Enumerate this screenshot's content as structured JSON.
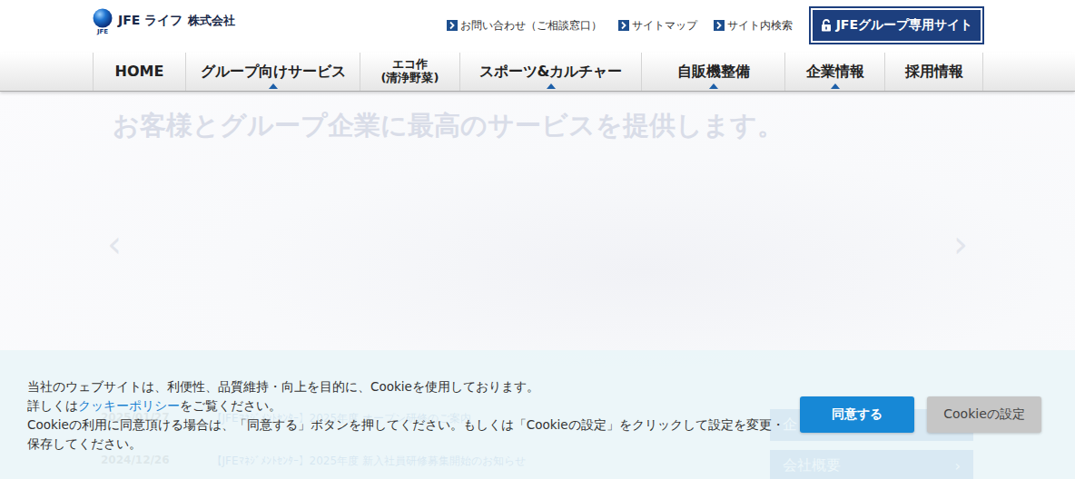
{
  "logo": {
    "mark": "JFE",
    "name": "JFE ライフ",
    "suffix": "株式会社"
  },
  "utility_links": [
    "お問い合わせ（ご相談窓口）",
    "サイトマップ",
    "サイト内検索"
  ],
  "group_site_button": "JFEグループ専用サイト",
  "nav": [
    {
      "lines": [
        "HOME"
      ],
      "has_submenu": false
    },
    {
      "lines": [
        "グループ向けサービス"
      ],
      "has_submenu": true
    },
    {
      "lines": [
        "エコ作",
        "(清浄野菜)"
      ],
      "has_submenu": false
    },
    {
      "lines": [
        "スポーツ&カルチャー"
      ],
      "has_submenu": true
    },
    {
      "lines": [
        "自販機整備"
      ],
      "has_submenu": true
    },
    {
      "lines": [
        "企業情報"
      ],
      "has_submenu": true
    },
    {
      "lines": [
        "採用情報"
      ],
      "has_submenu": false
    }
  ],
  "hero": {
    "headline": "お客様とグループ企業に最高のサービスを提供します。",
    "prev": "‹",
    "next": "›"
  },
  "news": [
    {
      "date": "2025/01/27",
      "title": "【JFEﾏﾈｼﾞﾒﾝﾄｾﾝﾀｰ】2025年度 オープン研修のご案内"
    },
    {
      "date": "2024/12/26",
      "title": "【JFEﾏﾈｼﾞﾒﾝﾄｾﾝﾀｰ】2025年度 新入社員研修募集開始のお知らせ"
    }
  ],
  "side_menu": [
    {
      "label": "企",
      "arrow": ""
    },
    {
      "label": "会社概要",
      "arrow": "›"
    }
  ],
  "cookie": {
    "line1": "当社のウェブサイトは、利便性、品質維持・向上を目的に、Cookieを使用しております。",
    "line2_before": "詳しくは",
    "line2_link": "クッキーポリシー",
    "line2_after": "をご覧ください。",
    "line3": "Cookieの利用に同意頂ける場合は、「同意する」ボタンを押してください。もしくは「Cookieの設定」をクリックして設定を変更・",
    "line4": "保存してください。",
    "accept": "同意する",
    "settings": "Cookieの設定"
  }
}
